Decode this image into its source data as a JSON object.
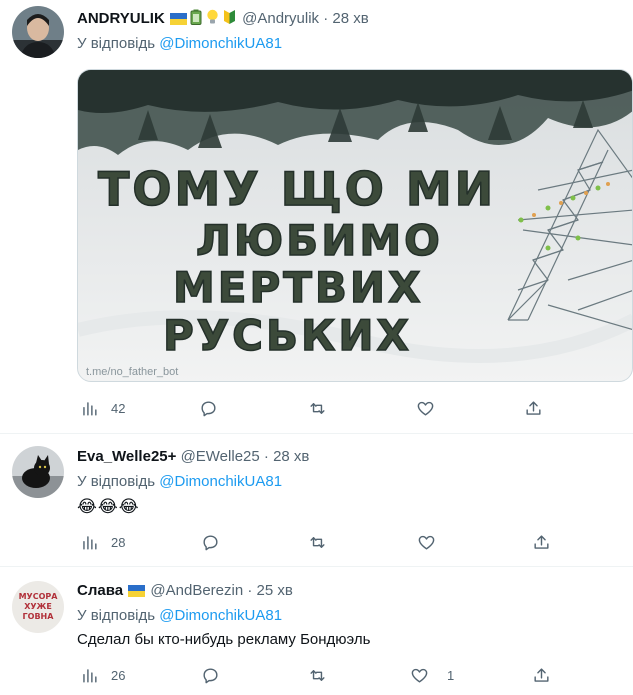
{
  "tweets": [
    {
      "name": "ANDRYULIK",
      "name_emojis": [
        "ukraine-flag",
        "battery",
        "light-bulb",
        "beginner-symbol"
      ],
      "handle": "@Andryulik",
      "time": "28 хв",
      "reply_prefix": "У відповідь",
      "reply_to": "@DimonchikUA81",
      "media_text_lines": [
        "ТОМУ ЩО МИ",
        "ЛЮБИМО",
        "МЕРТВИХ",
        "РУСЬКИХ"
      ],
      "media_watermark": "t.me/no_father_bot",
      "stats": {
        "views": "42",
        "replies": "",
        "retweets": "",
        "likes": ""
      }
    },
    {
      "name": "Eva_Welle25+",
      "handle": "@EWelle25",
      "time": "28 хв",
      "reply_prefix": "У відповідь",
      "reply_to": "@DimonchikUA81",
      "emoji_text": "😂😂😂",
      "stats": {
        "views": "28",
        "replies": "",
        "retweets": "",
        "likes": ""
      }
    },
    {
      "name": "Слава",
      "name_emojis": [
        "ukraine-flag"
      ],
      "handle": "@AndBerezin",
      "time": "25 хв",
      "reply_prefix": "У відповідь",
      "reply_to": "@DimonchikUA81",
      "text": "Сделал бы кто-нибудь рекламу Бондюэль",
      "avatar_sign": [
        "МУСОРА",
        "ХУЖЕ",
        "ГОВНА"
      ],
      "stats": {
        "views": "26",
        "replies": "",
        "retweets": "",
        "likes": "1"
      }
    }
  ],
  "colors": {
    "text": "#0f1419",
    "secondary": "#536471",
    "link": "#1d9bf0",
    "divider": "#eff3f4"
  },
  "separator": "·"
}
